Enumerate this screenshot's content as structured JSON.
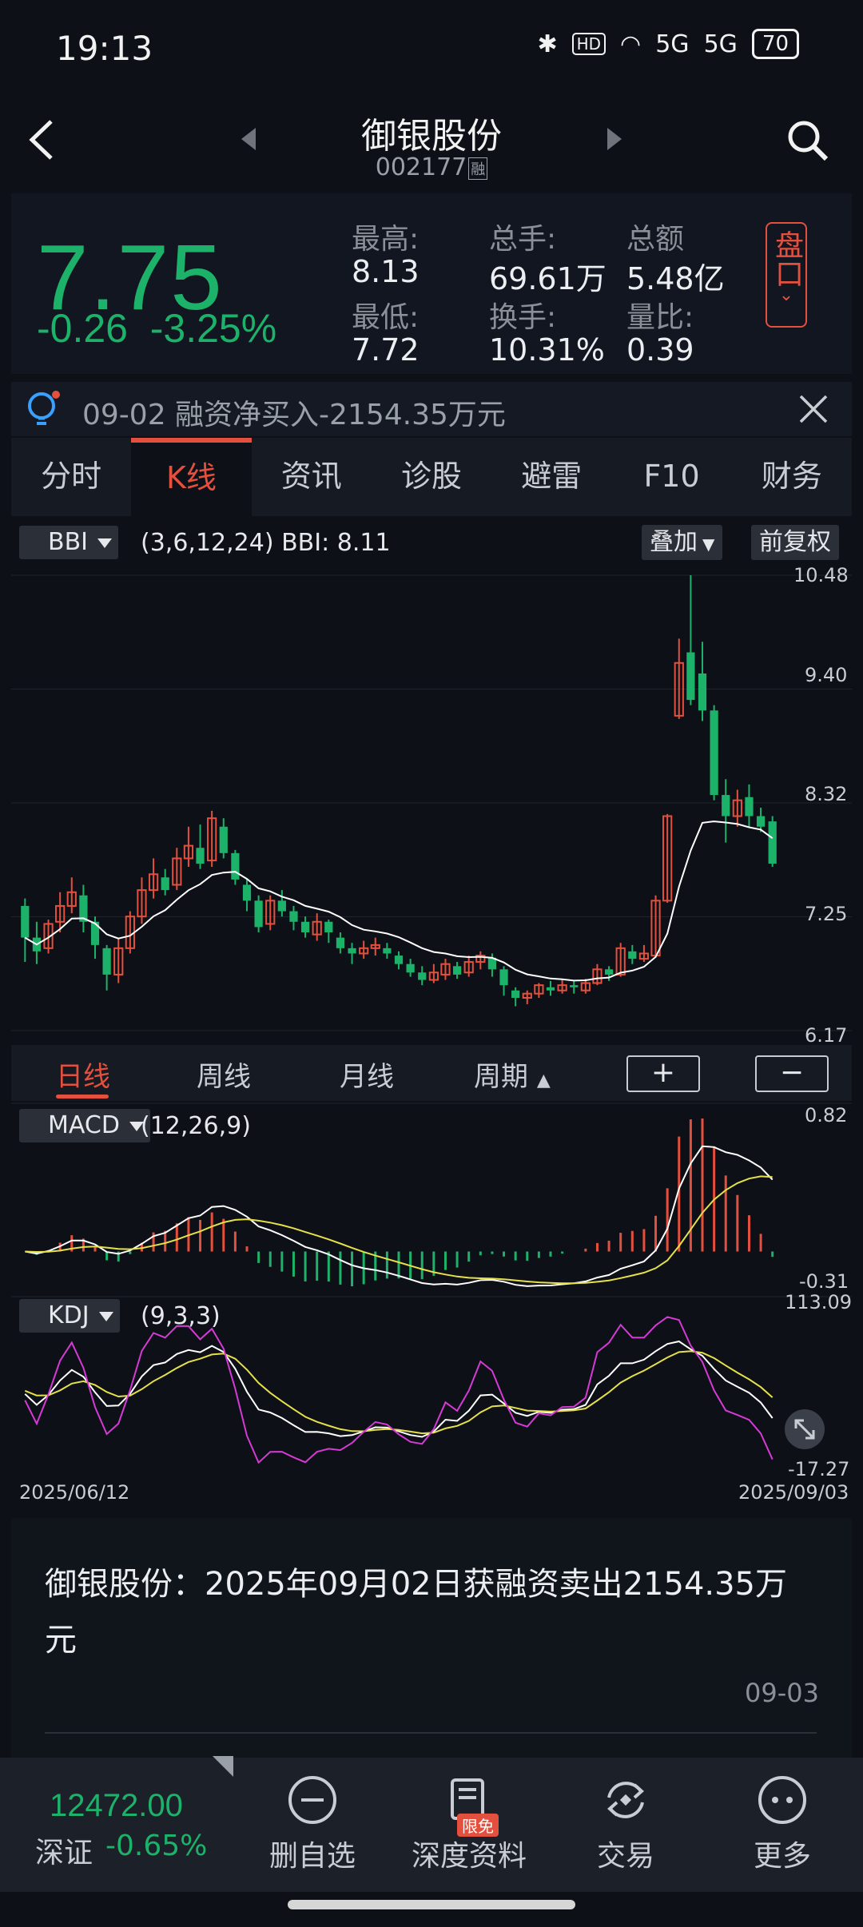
{
  "status_bar": {
    "time": "19:13",
    "battery": "70",
    "network": "5G",
    "hd": "HD"
  },
  "header": {
    "title": "御银股份",
    "code": "002177",
    "rong": "融"
  },
  "quote": {
    "price": "7.75",
    "change": "-0.26",
    "change_pct": "-3.25%",
    "fields": [
      {
        "label": "最高:",
        "value": "8.13"
      },
      {
        "label": "总手:",
        "value": "69.61万"
      },
      {
        "label": "总额",
        "value": "5.48亿"
      },
      {
        "label": "最低:",
        "value": "7.72"
      },
      {
        "label": "换手:",
        "value": "10.31%"
      },
      {
        "label": "量比:",
        "value": "0.39"
      }
    ],
    "pankou_label": "盘口",
    "up_color": "#e4503e",
    "down_color": "#1db26a"
  },
  "news_ticker": {
    "text": "09-02 融资净买入-2154.35万元"
  },
  "tabs": [
    "分时",
    "K线",
    "资讯",
    "诊股",
    "避雷",
    "F10",
    "财务"
  ],
  "active_tab": "K线",
  "main_chart": {
    "indicator": "BBI",
    "params": "(3,6,12,24) BBI: 8.11",
    "overlay_btn": "叠加",
    "adjust_btn": "前复权",
    "y_ticks": [
      "10.48",
      "9.40",
      "8.32",
      "7.25",
      "6.17"
    ]
  },
  "periods": {
    "items": [
      "日线",
      "周线",
      "月线",
      "周期"
    ],
    "active": "日线",
    "zoom_in": "+",
    "zoom_out": "−"
  },
  "macd": {
    "name": "MACD",
    "params": "(12,26,9)",
    "max": "0.82",
    "min": "-0.31"
  },
  "kdj": {
    "name": "KDJ",
    "params": "(9,3,3)",
    "max": "113.09",
    "min": "-17.27"
  },
  "dates": {
    "start": "2025/06/12",
    "end": "2025/09/03"
  },
  "chart_data": {
    "type": "candlestick",
    "title": "",
    "ylim": [
      6.17,
      10.48
    ],
    "candles": [
      [
        7.35,
        7.05,
        7.42,
        6.82
      ],
      [
        7.05,
        6.92,
        7.2,
        6.8
      ],
      [
        6.95,
        7.18,
        7.22,
        6.9
      ],
      [
        7.2,
        7.35,
        7.48,
        7.1
      ],
      [
        7.35,
        7.48,
        7.62,
        7.28
      ],
      [
        7.45,
        7.2,
        7.55,
        7.1
      ],
      [
        7.2,
        6.98,
        7.25,
        6.85
      ],
      [
        6.95,
        6.7,
        6.98,
        6.55
      ],
      [
        6.7,
        6.95,
        7.05,
        6.62
      ],
      [
        6.95,
        7.25,
        7.3,
        6.9
      ],
      [
        7.25,
        7.5,
        7.62,
        7.18
      ],
      [
        7.5,
        7.65,
        7.8,
        7.42
      ],
      [
        7.62,
        7.5,
        7.7,
        7.45
      ],
      [
        7.55,
        7.8,
        7.9,
        7.5
      ],
      [
        7.8,
        7.92,
        8.1,
        7.72
      ],
      [
        7.9,
        7.75,
        8.12,
        7.7
      ],
      [
        7.78,
        8.18,
        8.25,
        7.72
      ],
      [
        8.1,
        7.85,
        8.18,
        7.8
      ],
      [
        7.85,
        7.6,
        7.88,
        7.55
      ],
      [
        7.55,
        7.4,
        7.6,
        7.3
      ],
      [
        7.4,
        7.15,
        7.45,
        7.1
      ],
      [
        7.18,
        7.4,
        7.45,
        7.12
      ],
      [
        7.4,
        7.3,
        7.5,
        7.25
      ],
      [
        7.3,
        7.2,
        7.35,
        7.12
      ],
      [
        7.2,
        7.1,
        7.25,
        7.05
      ],
      [
        7.08,
        7.2,
        7.28,
        7.02
      ],
      [
        7.2,
        7.1,
        7.22,
        7.0
      ],
      [
        7.05,
        6.95,
        7.1,
        6.9
      ],
      [
        6.95,
        6.9,
        7.0,
        6.8
      ],
      [
        6.9,
        6.95,
        7.02,
        6.85
      ],
      [
        6.95,
        6.98,
        7.05,
        6.88
      ],
      [
        6.95,
        6.9,
        7.0,
        6.85
      ],
      [
        6.88,
        6.8,
        6.92,
        6.75
      ],
      [
        6.8,
        6.72,
        6.85,
        6.68
      ],
      [
        6.72,
        6.65,
        6.78,
        6.6
      ],
      [
        6.65,
        6.72,
        6.8,
        6.62
      ],
      [
        6.7,
        6.8,
        6.85,
        6.65
      ],
      [
        6.78,
        6.7,
        6.82,
        6.66
      ],
      [
        6.72,
        6.82,
        6.88,
        6.68
      ],
      [
        6.82,
        6.88,
        6.92,
        6.75
      ],
      [
        6.86,
        6.75,
        6.9,
        6.68
      ],
      [
        6.75,
        6.6,
        6.78,
        6.5
      ],
      [
        6.55,
        6.48,
        6.58,
        6.4
      ],
      [
        6.48,
        6.52,
        6.55,
        6.42
      ],
      [
        6.52,
        6.6,
        6.62,
        6.48
      ],
      [
        6.58,
        6.55,
        6.64,
        6.5
      ],
      [
        6.55,
        6.6,
        6.65,
        6.52
      ],
      [
        6.6,
        6.58,
        6.64,
        6.52
      ],
      [
        6.55,
        6.62,
        6.66,
        6.52
      ],
      [
        6.62,
        6.75,
        6.8,
        6.6
      ],
      [
        6.75,
        6.7,
        6.78,
        6.64
      ],
      [
        6.7,
        6.95,
        7.0,
        6.68
      ],
      [
        6.92,
        6.85,
        6.98,
        6.8
      ],
      [
        6.85,
        6.9,
        6.98,
        6.82
      ],
      [
        6.88,
        7.4,
        7.45,
        6.86
      ],
      [
        7.4,
        8.2,
        8.22,
        7.38
      ],
      [
        9.15,
        9.65,
        9.88,
        9.12
      ],
      [
        9.75,
        9.3,
        10.48,
        9.25
      ],
      [
        9.55,
        9.2,
        9.85,
        9.1
      ],
      [
        9.2,
        8.4,
        9.25,
        8.35
      ],
      [
        8.4,
        8.2,
        8.55,
        7.95
      ],
      [
        8.2,
        8.35,
        8.45,
        8.1
      ],
      [
        8.38,
        8.2,
        8.5,
        8.1
      ],
      [
        8.2,
        8.1,
        8.28,
        8.05
      ],
      [
        8.15,
        7.75,
        8.2,
        7.72
      ]
    ],
    "bbi_value": 8.11
  },
  "article": {
    "title": "御银股份：2025年09月02日获融资卖出2154.35万元",
    "date": "09-03"
  },
  "bottom_bar": {
    "index_value": "12472.00",
    "index_name": "深证",
    "index_change": "-0.65%",
    "items": [
      {
        "label": "删自选",
        "icon": "minus-circle-icon"
      },
      {
        "label": "深度资料",
        "icon": "document-icon",
        "badge": "限免"
      },
      {
        "label": "交易",
        "icon": "exchange-icon"
      },
      {
        "label": "更多",
        "icon": "more-icon"
      }
    ]
  }
}
